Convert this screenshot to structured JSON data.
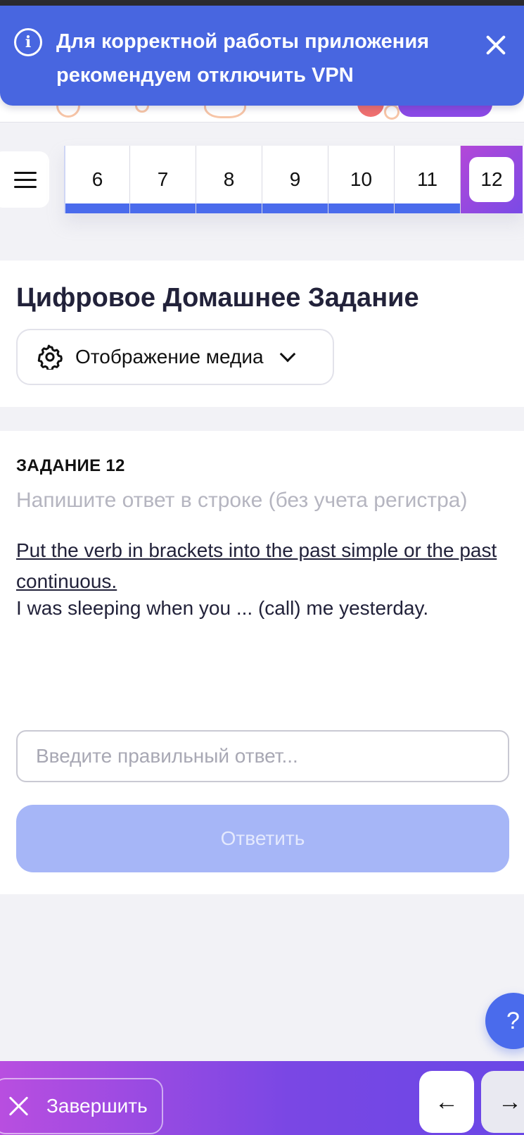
{
  "banner": {
    "text": "Для корректной работы приложения рекомендуем отключить VPN",
    "info_icon": "info-icon",
    "close_icon": "close-icon"
  },
  "question_nav": {
    "items": [
      "6",
      "7",
      "8",
      "9",
      "10",
      "11",
      "12"
    ],
    "active": "12"
  },
  "header": {
    "title": "Цифровое Домашнее Задание",
    "media_button_label": "Отображение медиа"
  },
  "task": {
    "number_label": "ЗАДАНИЕ 12",
    "hint": "Напишите ответ в строке (без учета регистра)",
    "instruction": "Put the verb in brackets into the past simple or the past continuous.",
    "sentence": "I was sleeping when you ... (call) me yesterday.",
    "answer_placeholder": "Введите правильный ответ...",
    "answer_value": "",
    "submit_label": "Ответить"
  },
  "help_label": "?",
  "footer": {
    "finish_label": "Завершить",
    "prev_icon": "←",
    "next_icon": "→"
  },
  "colors": {
    "accent": "#4a6bec",
    "banner": "#4866e0",
    "gradient_start": "#b84ee0",
    "gradient_end": "#6a47e6",
    "submit_disabled": "#a6b6f7"
  }
}
